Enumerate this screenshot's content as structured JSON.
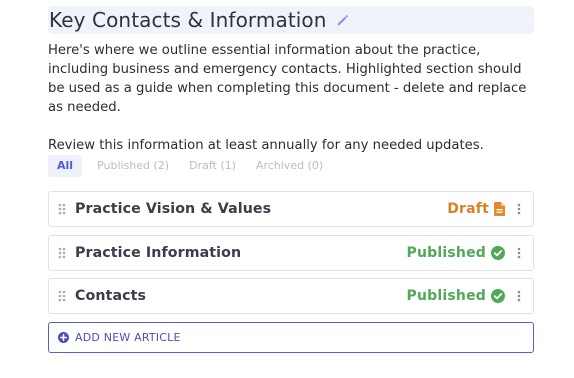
{
  "header": {
    "title": "Key Contacts & Information",
    "edit_icon": "pencil-icon"
  },
  "description": {
    "paragraph1": "Here's where we outline essential information about the practice, including business and emergency contacts. Highlighted section should be used as a guide when completing this document - delete and replace as needed.",
    "paragraph2": "Review this information at least annually for any needed updates."
  },
  "tabs": [
    {
      "label": "All",
      "active": true
    },
    {
      "label": "Published (2)",
      "active": false
    },
    {
      "label": "Draft (1)",
      "active": false
    },
    {
      "label": "Archived (0)",
      "active": false
    }
  ],
  "articles": [
    {
      "title": "Practice Vision & Values",
      "status": "Draft",
      "status_icon": "document-icon"
    },
    {
      "title": "Practice Information",
      "status": "Published",
      "status_icon": "check-circle-icon"
    },
    {
      "title": "Contacts",
      "status": "Published",
      "status_icon": "check-circle-icon"
    }
  ],
  "add_button": {
    "label": "ADD NEW ARTICLE",
    "icon": "plus-circle-icon"
  },
  "colors": {
    "accent": "#4d5bd1",
    "draft": "#d97f28",
    "published": "#4fa957",
    "title_bg": "#f1f3fb"
  }
}
